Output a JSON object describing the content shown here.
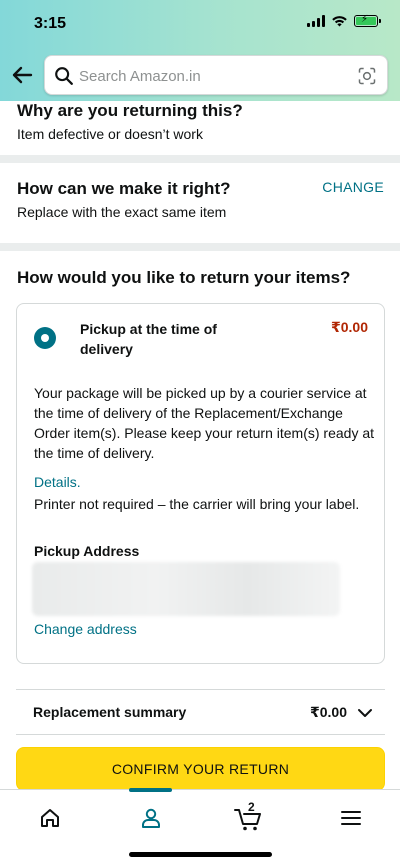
{
  "status_bar": {
    "time": "3:15"
  },
  "search": {
    "placeholder": "Search Amazon.in"
  },
  "return_reason": {
    "title": "Why are you returning this?",
    "value": "Item defective or doesn’t work"
  },
  "resolution": {
    "title": "How can we make it right?",
    "change_label": "CHANGE",
    "value": "Replace with the exact same item"
  },
  "return_method": {
    "title": "How would you like to return your items?",
    "option": {
      "label": "Pickup at the time of delivery",
      "price": "₹0.00",
      "description": "Your package will be picked up by a courier service at the time of delivery of the Replacement/Exchange Order item(s). Please keep your return item(s) ready at the time of delivery.",
      "details_link": "Details.",
      "printer_note": "Printer not required – the carrier will bring your label.",
      "address_label": "Pickup Address",
      "change_address": "Change address"
    }
  },
  "summary": {
    "label": "Replacement summary",
    "value": "₹0.00"
  },
  "confirm": {
    "label": "CONFIRM YOUR RETURN"
  },
  "nav": {
    "items": [
      "home-icon",
      "account-icon",
      "cart-icon",
      "menu-icon"
    ],
    "active": "account-icon",
    "cart_count": "2"
  },
  "colors": {
    "accent": "#007185",
    "price": "#b12704",
    "button": "#ffd814",
    "header_gradient": [
      "#83d8d9",
      "#b8e8c8"
    ]
  }
}
